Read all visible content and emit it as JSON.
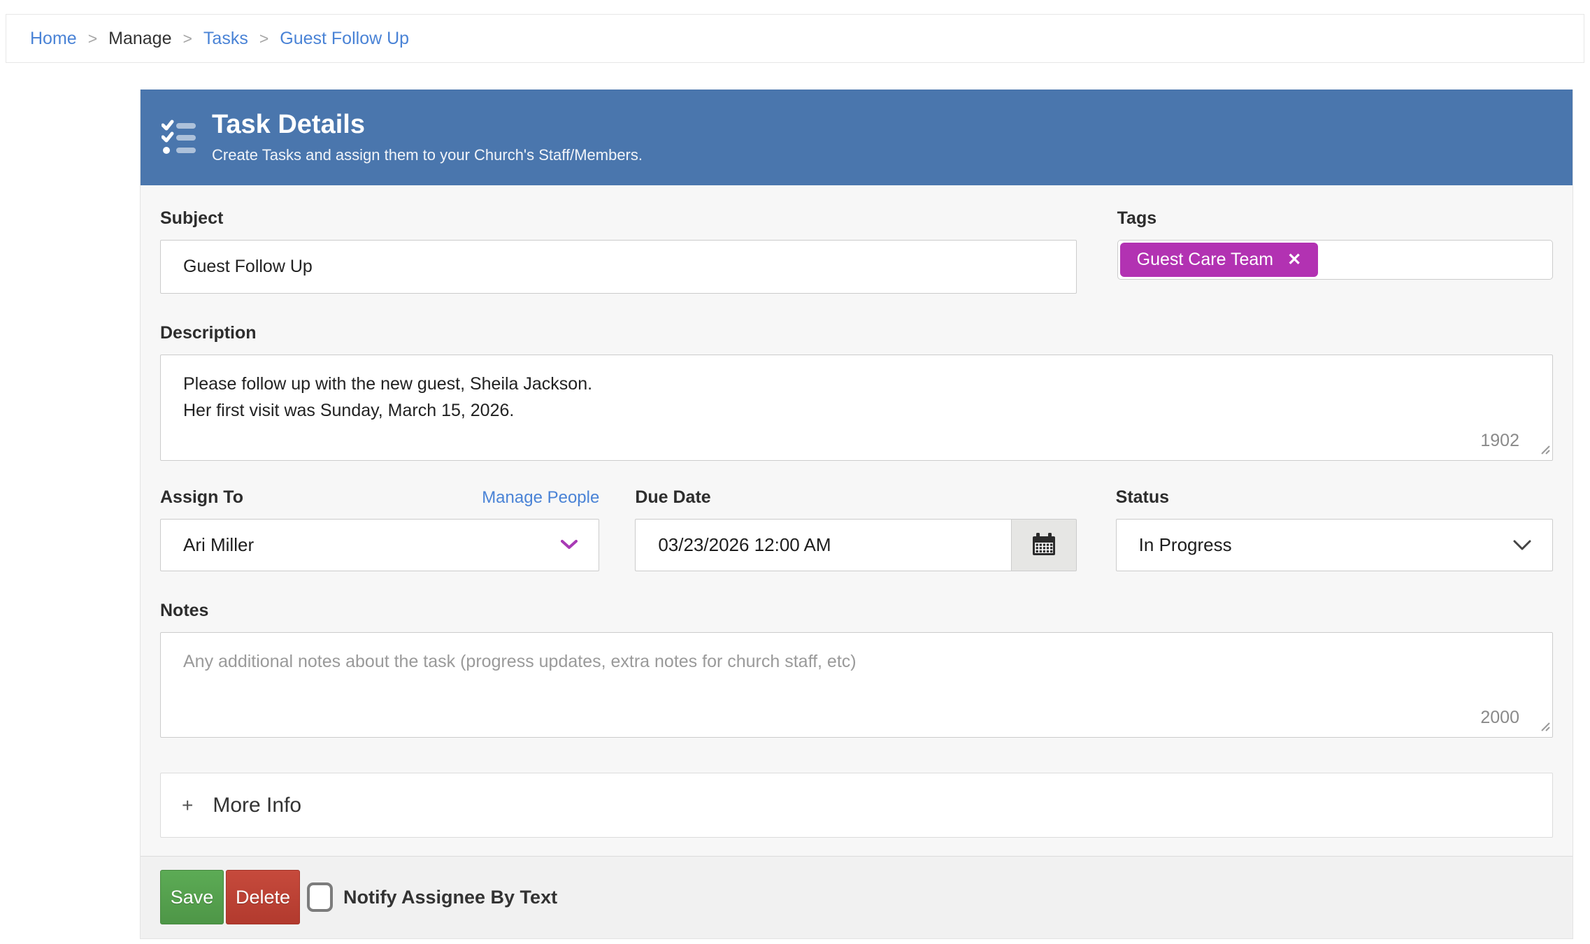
{
  "breadcrumb": {
    "separator": ">",
    "items": [
      {
        "label": "Home"
      },
      {
        "label": "Manage"
      },
      {
        "label": "Tasks"
      },
      {
        "label": "Guest Follow Up"
      }
    ]
  },
  "header": {
    "title": "Task Details",
    "subtitle": "Create Tasks and assign them to your Church's Staff/Members.",
    "icon": "task-list-icon"
  },
  "form": {
    "subject": {
      "label": "Subject",
      "value": "Guest Follow Up"
    },
    "tags": {
      "label": "Tags",
      "items": [
        {
          "label": "Guest Care Team",
          "remove_icon": "x-icon",
          "color": "#b232b2"
        }
      ]
    },
    "description": {
      "label": "Description",
      "value": "Please follow up with the new guest, Sheila Jackson.\nHer first visit was Sunday, March 15, 2026.",
      "remaining_chars": "1902"
    },
    "assign_to": {
      "label": "Assign To",
      "link_label": "Manage People",
      "value": "Ari Miller"
    },
    "due_date": {
      "label": "Due Date",
      "value": "03/23/2026 12:00 AM",
      "icon": "calendar-icon"
    },
    "status": {
      "label": "Status",
      "value": "In Progress"
    },
    "notes": {
      "label": "Notes",
      "placeholder": "Any additional notes about the task (progress updates, extra notes for church staff, etc)",
      "remaining_chars": "2000"
    },
    "more_info": {
      "expand_symbol": "+",
      "label": "More Info"
    }
  },
  "footer": {
    "save_label": "Save",
    "delete_label": "Delete",
    "notify_label": "Notify Assignee By Text",
    "notify_checked": false
  },
  "colors": {
    "header_background": "#4a76ad",
    "tag": "#b232b2",
    "link_blue": "#4a83d6",
    "save_green": "#55a04e",
    "delete_red": "#bd4234",
    "card_background": "#f7f7f7",
    "footer_background": "#f1f1f1"
  }
}
